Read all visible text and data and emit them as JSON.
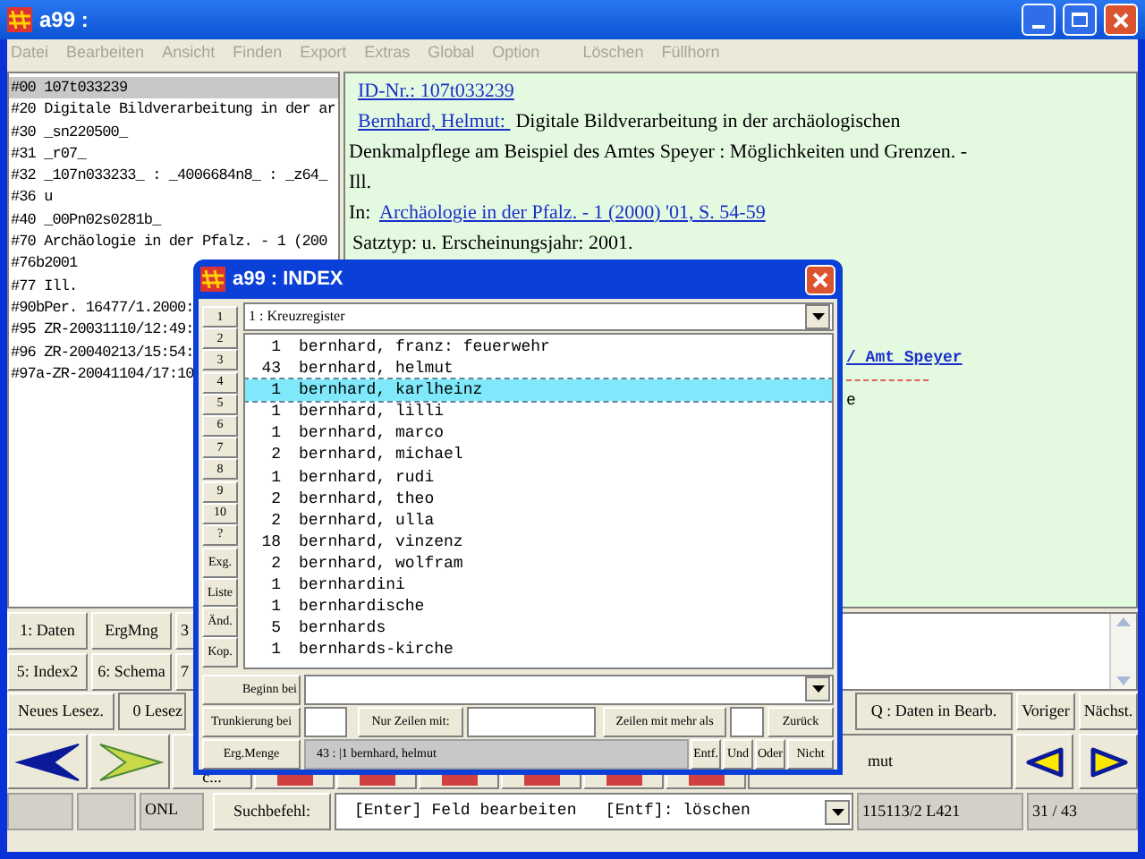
{
  "window": {
    "title": "a99 :"
  },
  "menu": [
    {
      "label": "Datei",
      "disabled": true
    },
    {
      "label": "Bearbeiten",
      "disabled": true
    },
    {
      "label": "Ansicht",
      "disabled": true
    },
    {
      "label": "Finden",
      "disabled": true
    },
    {
      "label": "Export",
      "disabled": true
    },
    {
      "label": "Extras",
      "disabled": true
    },
    {
      "label": "Global",
      "disabled": true
    },
    {
      "label": "Option",
      "disabled": true
    },
    {
      "label": "Löschen",
      "disabled": true
    },
    {
      "label": "Füllhorn",
      "disabled": true
    }
  ],
  "record_fields": [
    {
      "text": "#00 107t033239",
      "selected": true
    },
    {
      "text": "#20 Digitale Bildverarbeitung in der ar",
      "selected": false
    },
    {
      "text": "#30 _sn220500_",
      "selected": false
    },
    {
      "text": "#31 _r07_",
      "selected": false
    },
    {
      "text": "#32 _107n033233_ : _4006684n8_ : _z64_",
      "selected": false
    },
    {
      "text": "#36 u",
      "selected": false
    },
    {
      "text": "#40 _00Pn02s0281b_",
      "selected": false
    },
    {
      "text": "#70 Archäologie in der Pfalz. - 1 (200",
      "selected": false
    },
    {
      "text": "#76b2001",
      "selected": false
    },
    {
      "text": "#77 Ill.",
      "selected": false
    },
    {
      "text": "#90bPer. 16477/1.2000:",
      "selected": false
    },
    {
      "text": "#95 ZR-20031110/12:49:",
      "selected": false
    },
    {
      "text": "#96 ZR-20040213/15:54:",
      "selected": false
    },
    {
      "text": "#97a-ZR-20041104/17:10",
      "selected": false
    }
  ],
  "record_view": {
    "id_link": "ID-Nr.: 107t033239",
    "author_link": "Bernhard, Helmut: ",
    "title_start": "Digitale Bildverarbeitung in der archäologischen",
    "title_rest": "Denkmalpflege am Beispiel des Amtes Speyer : Möglichkeiten und Grenzen. -",
    "illustrations": "Ill.",
    "in_label": "In:",
    "source_link": "Archäologie in der Pfalz. - 1 (2000) '01, S. 54-59",
    "type_line": "Satztyp: u. Erscheinungsjahr: 2001.",
    "subject_link": "/ Amt Speyer",
    "fragment": "e"
  },
  "view_buttons": [
    [
      "1: Daten",
      "ErgMng",
      "3"
    ],
    [
      "5: Index2",
      "6: Schema",
      "7"
    ]
  ],
  "bookmark_button": "Neues Lesez.",
  "bookmark_count": "0 Lesez",
  "record_nav": {
    "status": "Q : Daten in Bearb.",
    "previous": "Voriger",
    "next": "Nächst."
  },
  "toolbar_label": "c...",
  "result_fragment": "mut",
  "status_bar": {
    "field_1": "ONL",
    "command_button": "Suchbefehl:",
    "command": "[Enter] Feld bearbeiten   [Entf]: löschen",
    "position": "115113/2 L421",
    "counter": "31 / 43"
  },
  "index_dialog": {
    "title": "a99 : INDEX",
    "side_buttons": [
      "1",
      "2",
      "3",
      "4",
      "5",
      "6",
      "7",
      "8",
      "9",
      "10",
      "?",
      "Exg.",
      "Liste",
      "Änd.",
      "Kop."
    ],
    "register": "1 : Kreuzregister",
    "entries": [
      {
        "count": "1",
        "term": "bernhard, franz: feuerwehr",
        "selected": false
      },
      {
        "count": "43",
        "term": "bernhard, helmut",
        "selected": false
      },
      {
        "count": "1",
        "term": "bernhard, karlheinz",
        "selected": true
      },
      {
        "count": "1",
        "term": "bernhard, lilli",
        "selected": false
      },
      {
        "count": "1",
        "term": "bernhard, marco",
        "selected": false
      },
      {
        "count": "2",
        "term": "bernhard, michael",
        "selected": false
      },
      {
        "count": "1",
        "term": "bernhard, rudi",
        "selected": false
      },
      {
        "count": "2",
        "term": "bernhard, theo",
        "selected": false
      },
      {
        "count": "2",
        "term": "bernhard, ulla",
        "selected": false
      },
      {
        "count": "18",
        "term": "bernhard, vinzenz",
        "selected": false
      },
      {
        "count": "2",
        "term": "bernhard, wolfram",
        "selected": false
      },
      {
        "count": "1",
        "term": "bernhardini",
        "selected": false
      },
      {
        "count": "1",
        "term": "bernhardische",
        "selected": false
      },
      {
        "count": "5",
        "term": "bernhards",
        "selected": false
      },
      {
        "count": "1",
        "term": "bernhards-kirche",
        "selected": false
      }
    ],
    "start_button": "Beginn bei",
    "truncation_button": "Trunkierung bei",
    "lines_with_button": "Nur Zeilen mit:",
    "lines_more_button": "Zeilen mit mehr als",
    "back_button": "Zurück",
    "result_button": "Erg.Menge",
    "result_value": "43 : |1 bernhard, helmut",
    "operators": [
      "Entf.",
      "Und",
      "Oder",
      "Nicht"
    ]
  }
}
